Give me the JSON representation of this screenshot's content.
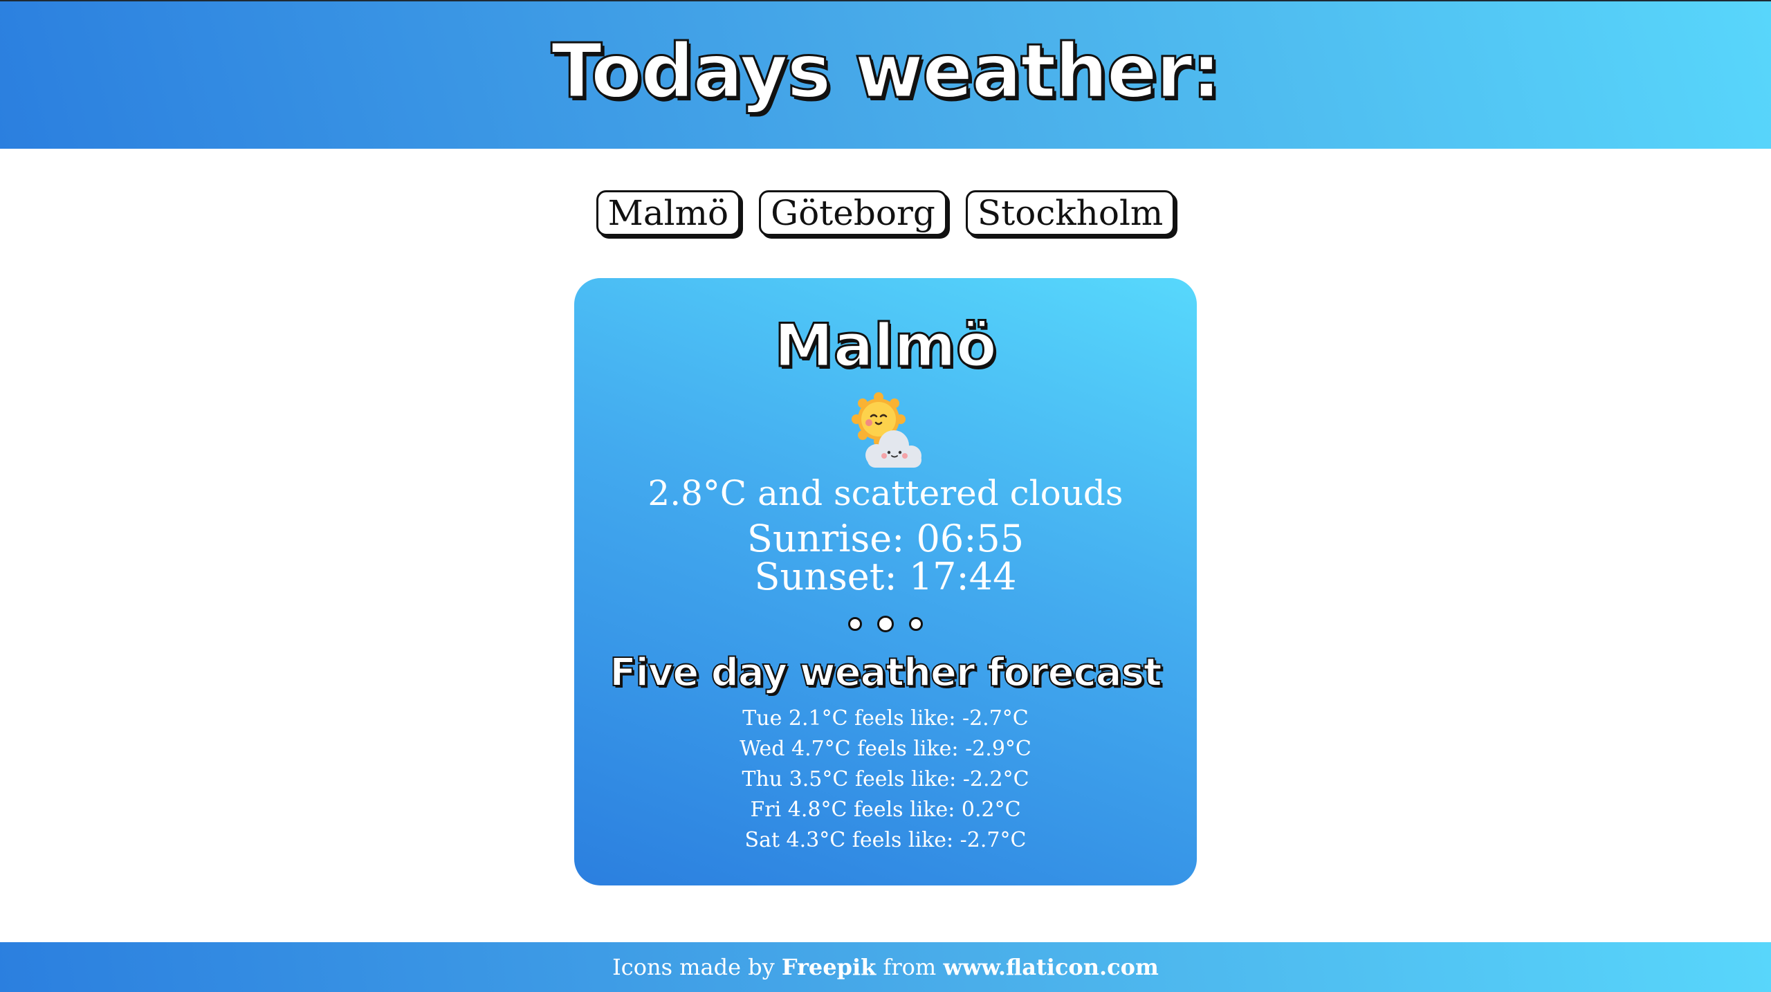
{
  "header": {
    "title": "Todays weather:"
  },
  "city_buttons": [
    "Malmö",
    "Göteborg",
    "Stockholm"
  ],
  "card": {
    "city": "Malmö",
    "icon": "sun-behind-cloud-icon",
    "summary": "2.8°C and scattered clouds",
    "sunrise": "Sunrise: 06:55",
    "sunset": "Sunset: 17:44",
    "forecast_title": "Five day weather forecast",
    "forecast": [
      "Tue 2.1°C feels like: -2.7°C",
      "Wed 4.7°C feels like: -2.9°C",
      "Thu 3.5°C feels like: -2.2°C",
      "Fri 4.8°C feels like: 0.2°C",
      "Sat 4.3°C feels like: -2.7°C"
    ]
  },
  "footer": {
    "prefix": "Icons made by ",
    "author": "Freepik",
    "middle": " from ",
    "site": "www.flaticon.com"
  },
  "colors": {
    "gradient_start": "#2b7fdf",
    "gradient_end": "#58d6fb",
    "outline": "#111111"
  }
}
